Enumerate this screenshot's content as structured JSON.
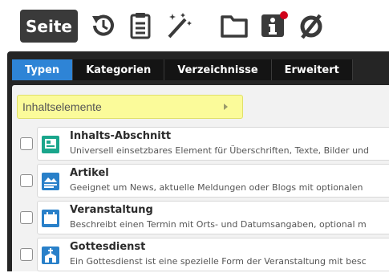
{
  "toolbar": {
    "page_button": "Seite",
    "icons": [
      "history-icon",
      "clipboard-icon",
      "magic-wand-icon",
      "folder-icon",
      "info-icon",
      "empty-set-icon"
    ],
    "notification_color": "#d0021b"
  },
  "tabs": [
    {
      "label": "Typen",
      "active": true
    },
    {
      "label": "Kategorien",
      "active": false
    },
    {
      "label": "Verzeichnisse",
      "active": false
    },
    {
      "label": "Erweitert",
      "active": false
    }
  ],
  "filter": {
    "selected": "Inhaltselemente"
  },
  "items": [
    {
      "title": "Inhalts-Abschnitt",
      "description": "Universell einsetzbares Element für Überschriften, Texte, Bilder und",
      "icon": "content-section-icon",
      "icon_color": "#1aa68c"
    },
    {
      "title": "Artikel",
      "description": "Geeignet um News, aktuelle Meldungen oder Blogs mit optionalen",
      "icon": "article-icon",
      "icon_color": "#2980c9"
    },
    {
      "title": "Veranstaltung",
      "description": "Beschreibt einen Termin mit Orts- und Datumsangaben, optional m",
      "icon": "calendar-icon",
      "icon_color": "#2980c9"
    },
    {
      "title": "Gottesdienst",
      "description": "Ein Gottesdienst ist eine spezielle Form der Veranstaltung mit besc",
      "icon": "church-icon",
      "icon_color": "#2980c9"
    }
  ],
  "colors": {
    "active_tab": "#2e84d6",
    "panel": "#252525",
    "highlight": "#fbfb9a"
  }
}
